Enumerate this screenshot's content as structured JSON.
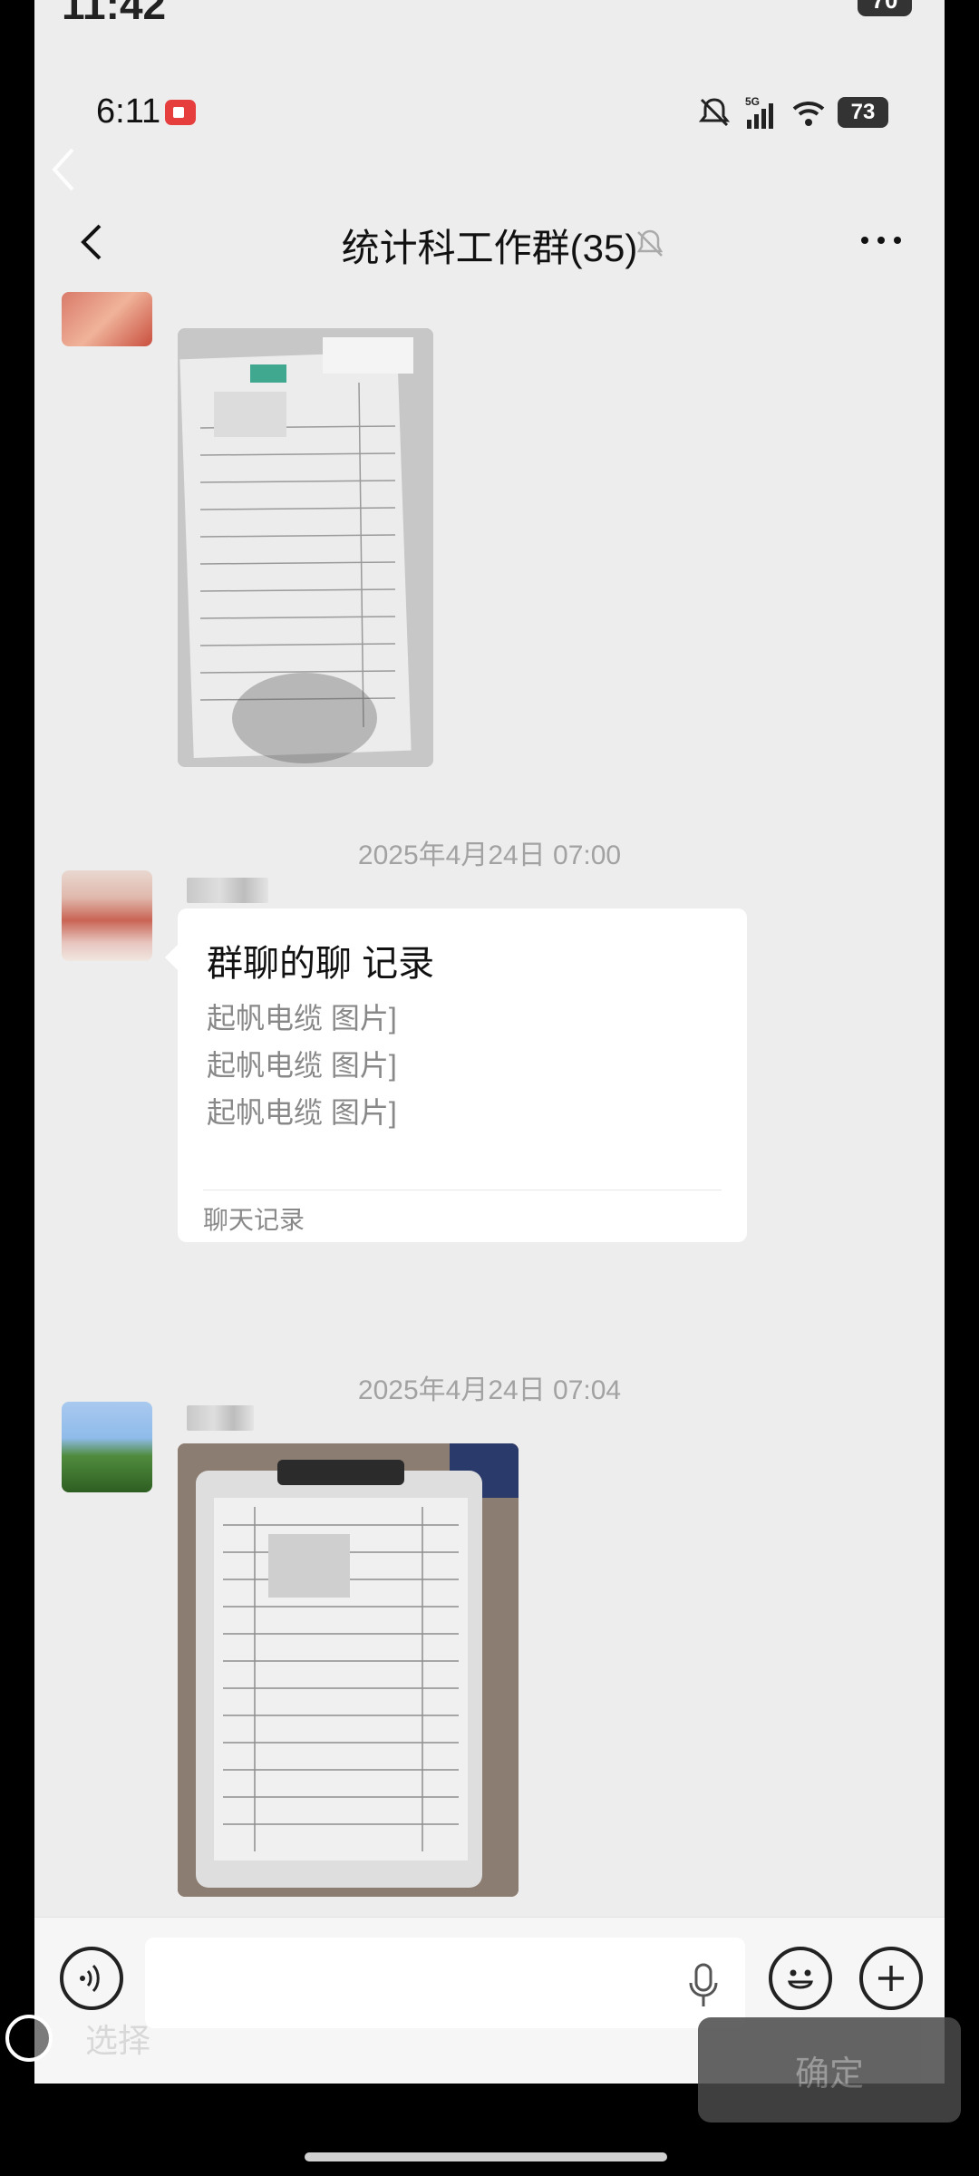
{
  "outer_status": {
    "time": "11:42",
    "battery": "70"
  },
  "status_bar": {
    "time": "6:11",
    "battery": "73",
    "network": "5G"
  },
  "nav": {
    "title": "统计科工作群(35)"
  },
  "messages": {
    "timestamp_1": "2025年4月24日 07:00",
    "timestamp_2": "2025年4月24日 07:04",
    "record_card": {
      "title": "群聊的聊 记录",
      "lines": [
        "起帆电缆 图片]",
        "起帆电缆 图片]",
        "起帆电缆 图片]"
      ],
      "footer": "聊天记录"
    }
  },
  "input_bar": {
    "placeholder": ""
  },
  "selection": {
    "select_label": "选择",
    "confirm_label": "确定"
  },
  "icons": [
    "back-icon",
    "mute-icon",
    "more-icon",
    "voice-icon",
    "mic-icon",
    "emoji-icon",
    "plus-icon"
  ]
}
